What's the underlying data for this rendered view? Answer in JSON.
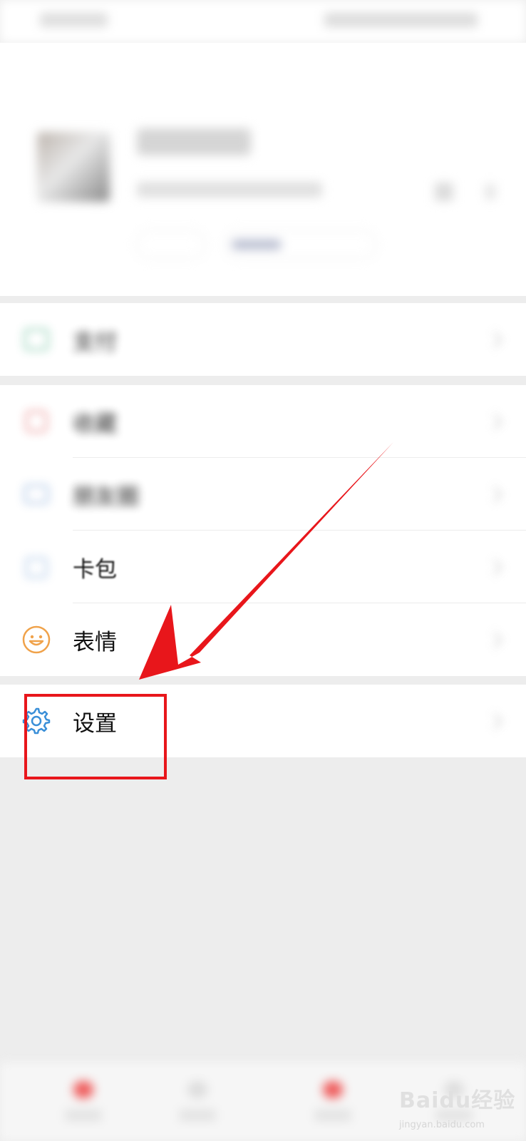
{
  "menu": {
    "items": [
      {
        "label": "支付"
      },
      {
        "label": "收藏"
      },
      {
        "label": "朋友圈"
      },
      {
        "label": "卡包"
      },
      {
        "label": "表情"
      },
      {
        "label": "设置"
      }
    ]
  },
  "icons": {
    "emoji": "smile-face-icon",
    "settings": "gear-icon"
  },
  "colors": {
    "emoji_icon": "#f0a24a",
    "settings_icon": "#3a8fd8",
    "highlight": "#e8161b",
    "background": "#ededed"
  },
  "watermark": {
    "text": "Baidu经验",
    "sub": "jingyan.baidu.com"
  }
}
